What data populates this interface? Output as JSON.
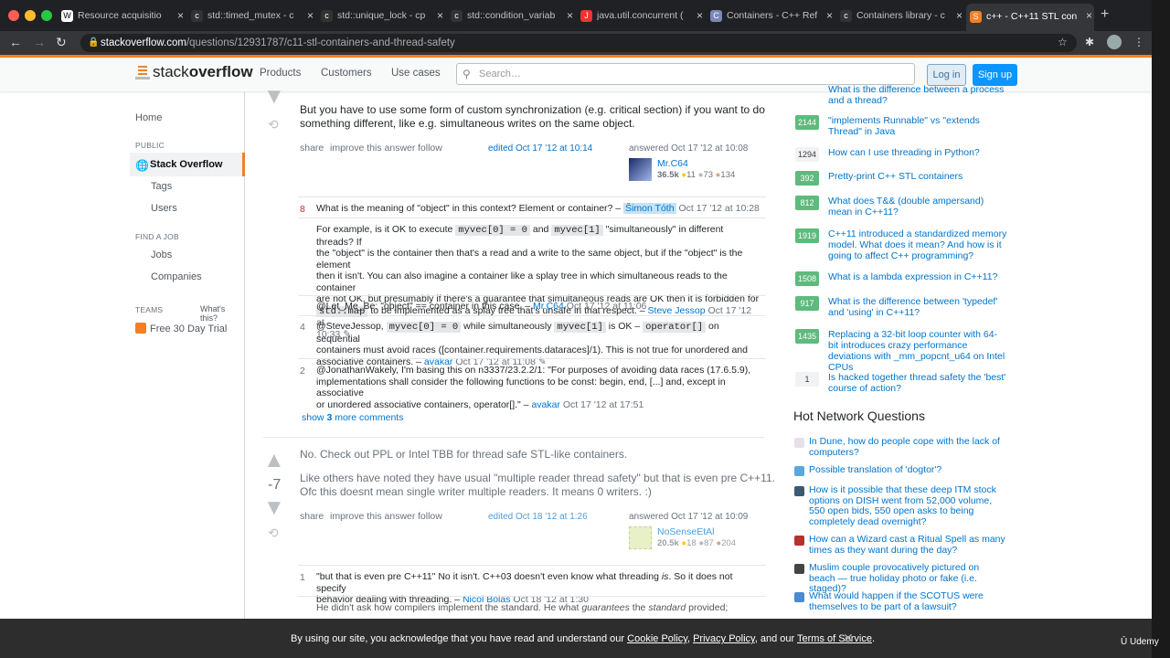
{
  "browser": {
    "tabs": [
      {
        "title": "Resource acquisitio",
        "icon": "W",
        "color": "#ffffff"
      },
      {
        "title": "std::timed_mutex - c",
        "icon": "c",
        "color": "#333"
      },
      {
        "title": "std::unique_lock - cp",
        "icon": "c",
        "color": "#333"
      },
      {
        "title": "std::condition_variab",
        "icon": "c",
        "color": "#333"
      },
      {
        "title": "java.util.concurrent (",
        "icon": "J",
        "color": "#e33"
      },
      {
        "title": "Containers - C++ Ref",
        "icon": "C",
        "color": "#7a8ab8"
      },
      {
        "title": "Containers library - c",
        "icon": "c",
        "color": "#333"
      },
      {
        "title": "c++ - C++11 STL con",
        "icon": "S",
        "color": "#f48024"
      }
    ],
    "url_host": "stackoverflow.com",
    "url_path": "/questions/12931787/c11-stl-containers-and-thread-safety"
  },
  "header": {
    "logo_a": "stack",
    "logo_b": "overflow",
    "nav": [
      "Products",
      "Customers",
      "Use cases"
    ],
    "search_placeholder": "Search…",
    "login": "Log in",
    "signup": "Sign up"
  },
  "leftnav": {
    "home": "Home",
    "public": "PUBLIC",
    "so": "Stack Overflow",
    "tags": "Tags",
    "users": "Users",
    "findjob": "FIND A JOB",
    "jobs": "Jobs",
    "companies": "Companies",
    "teams": "TEAMS",
    "whats": "What's this?",
    "trial": "Free 30 Day Trial"
  },
  "answer1": {
    "text1": "But you have to use some form of custom synchronization (e.g. critical section) if you want to do",
    "text2": "something different, like e.g. simultaneous writes on the same object.",
    "share": "share",
    "improve": "improve this answer",
    "follow": "follow",
    "edited": "edited Oct 17 '12 at 10:14",
    "answered": "answered Oct 17 '12 at 10:08",
    "user": "Mr.C64",
    "rep": "36.5k",
    "gold": "11",
    "silver": "73",
    "bronze": "134"
  },
  "comments": [
    {
      "score": "8",
      "lines": [
        "What is the meaning of \"object\" in this context? Element or container? –"
      ],
      "user": "Šimon Tóth",
      "date": "Oct 17 '12 at 10:28"
    },
    {
      "score": "",
      "lines": []
    },
    {
      "score": "",
      "text": "@Let_Me_Be: \"object\" == container in this case. –",
      "user": "Mr.C64",
      "date": "Oct 17 '12 at 11:06"
    },
    {
      "score": "4"
    },
    {
      "score": "2"
    }
  ],
  "c2": {
    "l1a": "For example, is it OK to execute",
    "c1": "myvec[0] = 0",
    "l1b": "and",
    "c2": "myvec[1]",
    "l1c": "\"simultaneously\" in different threads? If",
    "l2": "the \"object\" is the container then that's a read and a write to the same object, but if the \"object\" is the element",
    "l3": "then it isn't. You can also imagine a container like a splay tree in which simultaneous reads to the container",
    "l4": "are not OK, but presumably if there's a guarantee that simultaneous reads are OK then it is forbidden for",
    "c3": "std::map",
    "l5": "to be implemented as a splay tree that's unsafe in that respect. –",
    "user": "Steve Jessop",
    "date": "Oct 17 '12 at",
    "date2": "10:33"
  },
  "c4": {
    "a": "@SteveJessop,",
    "c1": "myvec[0] = 0",
    "b": "while simultaneously",
    "c2": "myvec[1]",
    "c": "is OK –",
    "c3": "operator[]",
    "d": "on sequential",
    "l2": "containers must avoid races ([container.requirements.dataraces]/1). This is not true for unordered and",
    "l3": "associative containers. –",
    "user": "avakar",
    "date": "Oct 17 '12 at 11:08"
  },
  "c5": {
    "l1": "@JonathanWakely, I'm basing this on n3337/23.2.2/1: \"For purposes of avoiding data races (17.6.5.9),",
    "l2": "implementations shall consider the following functions to be const: begin, end, [...] and, except in associative",
    "l3": "or unordered associative containers, operator[].\" –",
    "user": "avakar",
    "date": "Oct 17 '12 at 17:51"
  },
  "showmore": {
    "a": "show",
    "n": "3",
    "b": "more comments"
  },
  "answer2": {
    "score": "-7",
    "t1": "No. Check out PPL or Intel TBB for thread safe STL-like containers.",
    "t2": "Like others have noted they have usual \"multiple reader thread safety\" but that is even pre C++11.",
    "t3": "Ofc this doesnt mean single writer multiple readers. It means 0 writers. :)",
    "share": "share",
    "improve": "improve this answer",
    "follow": "follow",
    "edited": "edited Oct 18 '12 at 1:26",
    "answered": "answered Oct 17 '12 at 10:09",
    "user": "NoSenseEtAl",
    "rep": "20.5k",
    "gold": "18",
    "silver": "87",
    "bronze": "204"
  },
  "a2c1": {
    "score": "1",
    "l1a": "\"but that is even pre C++11\" No it isn't. C++03 doesn't even know what threading",
    "l1b": "is",
    ". So it does not specify": "",
    "l1c": ". So it does not specify",
    "l2": "behavior dealing with threading. –",
    "user": "Nicol Bolas",
    "date": "Oct 18 '12 at 1:30"
  },
  "a2c2": {
    "l1a": "He didn't ask how compilers implement the standard. He what",
    "em1": "guarantees",
    "l1b": "the",
    "em2": "standard",
    "l1c": "provided;"
  },
  "related": [
    {
      "count": "",
      "q": "What is the difference between a process and a thread?"
    },
    {
      "count": "2144",
      "q": "\"implements Runnable\" vs \"extends Thread\" in Java"
    },
    {
      "count": "1294",
      "q": "How can I use threading in Python?"
    },
    {
      "count": "392",
      "q": "Pretty-print C++ STL containers"
    },
    {
      "count": "812",
      "q": "What does T&& (double ampersand) mean in C++11?"
    },
    {
      "count": "1919",
      "q": "C++11 introduced a standardized memory model. What does it mean? And how is it going to affect C++ programming?"
    },
    {
      "count": "1508",
      "q": "What is a lambda expression in C++11?"
    },
    {
      "count": "917",
      "q": "What is the difference between 'typedef' and 'using' in C++11?"
    },
    {
      "count": "1435",
      "q": "Replacing a 32-bit loop counter with 64-bit introduces crazy performance deviations with _mm_popcnt_u64 on Intel CPUs"
    },
    {
      "count": "1",
      "q": "Is hacked together thread safety the 'best' course of action?"
    }
  ],
  "hnq_title": "Hot Network Questions",
  "hnq": [
    {
      "q": "In Dune, how do people cope with the lack of computers?",
      "c": "#e6e0e8"
    },
    {
      "q": "Possible translation of 'dogtor'?",
      "c": "#5aa7e0"
    },
    {
      "q": "How is it possible that these deep ITM stock options on DISH went from 52,000 volume, 550 open bids, 550 open asks to being completely dead overnight?",
      "c": "#3a5a74"
    },
    {
      "q": "How can a Wizard cast a Ritual Spell as many times as they want during the day?",
      "c": "#b9312c"
    },
    {
      "q": "Muslim couple provocatively pictured on beach — true holiday photo or fake (i.e. staged)?",
      "c": "#444"
    },
    {
      "q": "What would happen if the SCOTUS were themselves to be part of a lawsuit?",
      "c": "#4a8ad0"
    }
  ],
  "cookie": {
    "a": "By using our site, you acknowledge that you have read and understand our",
    "l1": "Cookie Policy",
    ",": ", ",
    "l2": "Privacy Policy",
    "b": ", and our",
    "l3": "Terms of Service",
    "c": "."
  },
  "udemy": "Udemy"
}
